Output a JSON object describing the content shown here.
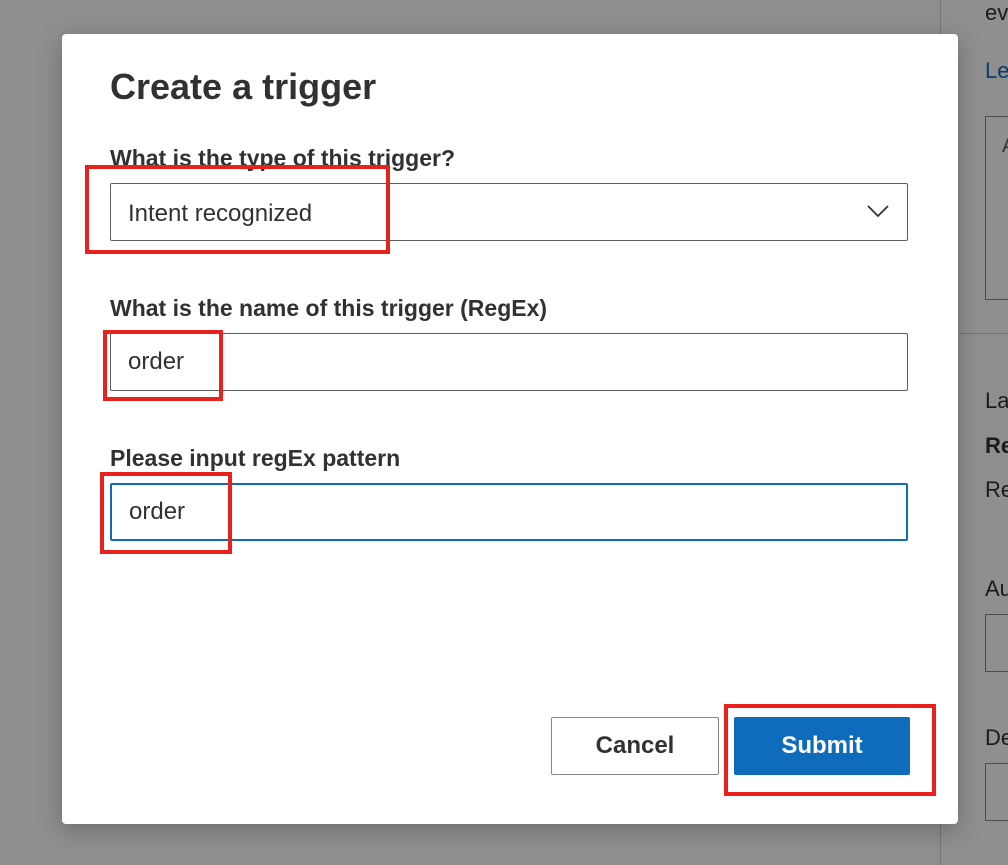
{
  "background": {
    "fragments": [
      "ev",
      "Le",
      "A",
      "La",
      "Re",
      "Re",
      "Au",
      "De"
    ]
  },
  "dialog": {
    "title": "Create a trigger",
    "trigger_type": {
      "label": "What is the type of this trigger?",
      "selected_value": "Intent recognized",
      "icon": "chevron-down-icon"
    },
    "trigger_name": {
      "label": "What is the name of this trigger (RegEx)",
      "value": "order"
    },
    "regex_pattern": {
      "label": "Please input regEx pattern",
      "value": "order"
    },
    "buttons": {
      "cancel_label": "Cancel",
      "submit_label": "Submit"
    }
  },
  "colors": {
    "accent": "#0f6cbd",
    "highlight": "#e8211c",
    "text": "#323130",
    "overlay": "rgba(0,0,0,0.44)"
  }
}
